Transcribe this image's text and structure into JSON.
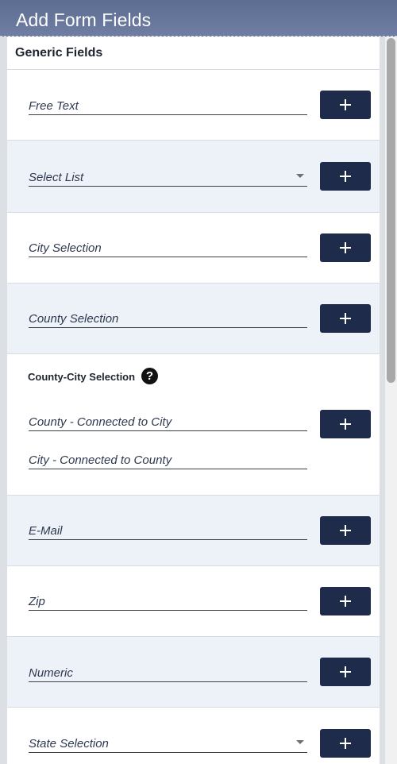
{
  "header": {
    "title": "Add Form Fields"
  },
  "section": {
    "title": "Generic Fields"
  },
  "fields": [
    {
      "label": "Free Text"
    },
    {
      "label": "Select List",
      "has_dropdown": true
    },
    {
      "label": "City Selection"
    },
    {
      "label": "County Selection"
    }
  ],
  "county_city": {
    "title": "County-City Selection",
    "help_glyph": "?",
    "county_label": "County - Connected to City",
    "city_label": "City - Connected to County"
  },
  "fields_after": [
    {
      "label": "E-Mail"
    },
    {
      "label": "Zip"
    },
    {
      "label": "Numeric"
    },
    {
      "label": "State Selection",
      "has_dropdown": true
    }
  ],
  "colors": {
    "header_bg": "#6a79a0",
    "button_bg": "#1f2b4a",
    "shaded_row": "#edf1f8"
  },
  "icons": {
    "add": "plus-icon",
    "help": "question-circle-icon",
    "dropdown": "caret-down-icon"
  }
}
